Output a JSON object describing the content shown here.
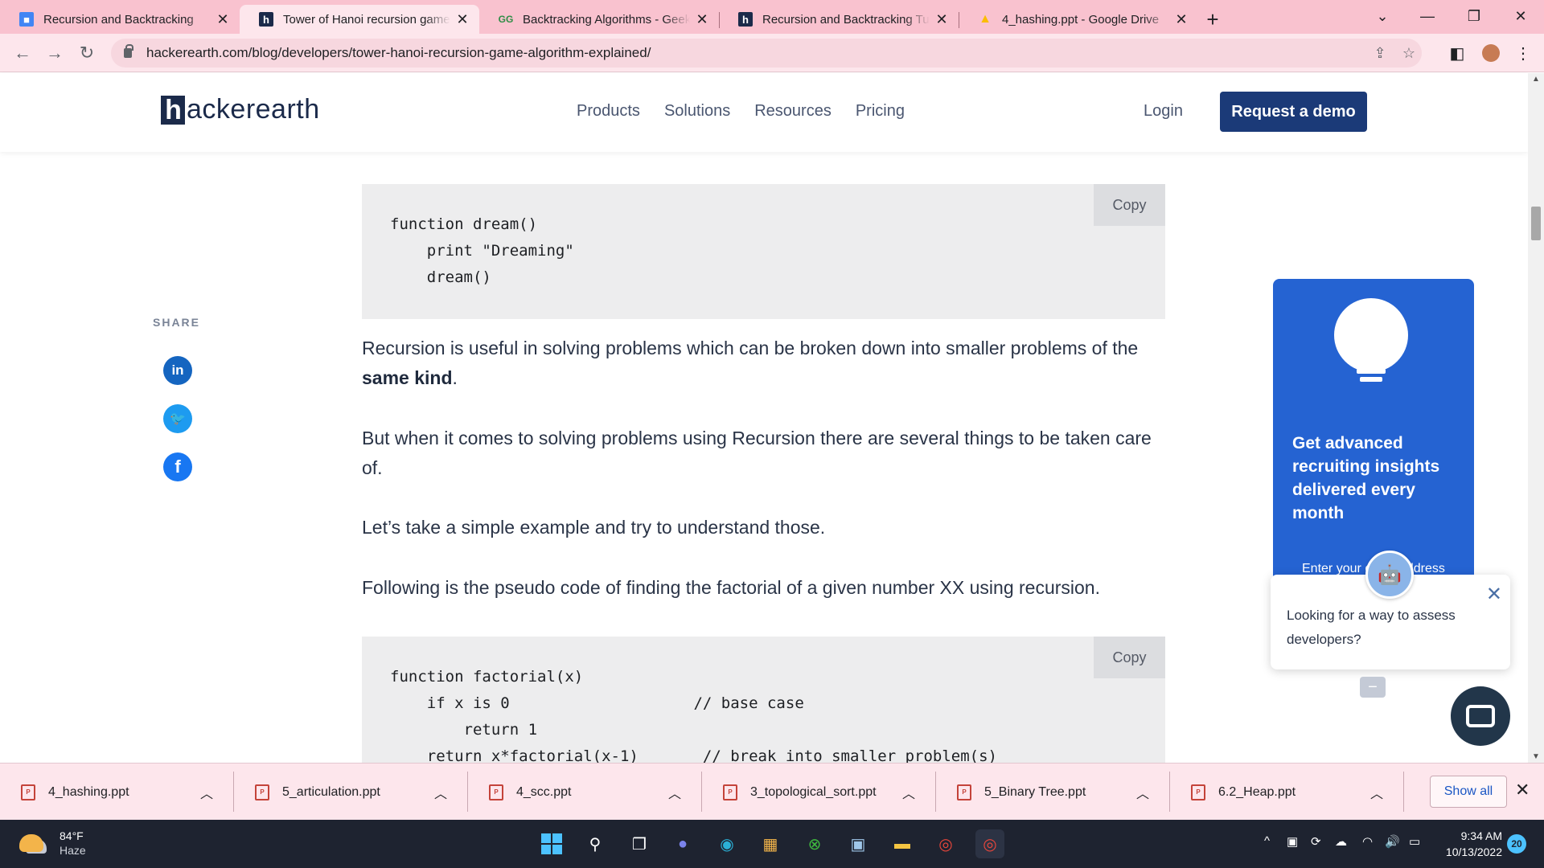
{
  "browser": {
    "tabs": [
      {
        "title": "Recursion and Backtracking",
        "favicon": "account-icon",
        "favicon_color": "#4285f4",
        "active": false
      },
      {
        "title": "Tower of Hanoi recursion game algorithm explained",
        "favicon": "hackerearth-icon",
        "favicon_color": "#1b2a4a",
        "active": true
      },
      {
        "title": "Backtracking Algorithms - GeeksforGeeks",
        "favicon": "geeksforgeeks-icon",
        "favicon_color": "#2f8d46",
        "active": false
      },
      {
        "title": "Recursion and Backtracking Tutorials",
        "favicon": "hackerearth-icon",
        "favicon_color": "#1b2a4a",
        "active": false
      },
      {
        "title": "4_hashing.ppt - Google Drive",
        "favicon": "google-drive-icon",
        "favicon_color": "#fbbc04",
        "active": false
      }
    ],
    "url": "hackerearth.com/blog/developers/tower-hanoi-recursion-game-algorithm-explained/",
    "tab_color": "#f9c2cf"
  },
  "site": {
    "logo_letter": "h",
    "logo_rest": "ackerearth",
    "nav": [
      "Products",
      "Solutions",
      "Resources",
      "Pricing"
    ],
    "login": "Login",
    "cta": "Request a demo",
    "brand_color": "#1b3a78"
  },
  "article": {
    "code1": "function dream()\n    print \"Dreaming\"\n    dream()",
    "copy_label": "Copy",
    "p1_before": "Recursion is useful in solving problems which can be broken down into smaller problems of the ",
    "p1_bold": "same kind",
    "p1_after": ".",
    "p2": "But when it comes to solving problems using Recursion there are several things to be taken care of.",
    "p3": "Let’s take a simple example and try to understand those.",
    "p4": "Following is the pseudo code of finding the factorial of a given number XX using recursion.",
    "code2": "function factorial(x)\n    if x is 0                    // base case\n        return 1\n    return x*factorial(x-1)       // break into smaller problem(s)",
    "share_label": "SHARE",
    "share_icons": [
      "linkedin-icon",
      "twitter-icon",
      "facebook-icon"
    ]
  },
  "sidebar": {
    "promo_headline": "Get advanced recruiting insights delivered every month",
    "promo_email_placeholder": "Enter your email address",
    "chat_message": "Looking for a way to assess developers?",
    "promo_color": "#2563d2"
  },
  "downloads": {
    "items": [
      "4_hashing.ppt",
      "5_articulation.ppt",
      "4_scc.ppt",
      "3_topological_sort.ppt",
      "5_Binary Tree.ppt",
      "6.2_Heap.ppt"
    ],
    "show_all": "Show all"
  },
  "taskbar": {
    "temperature": "84°F",
    "condition": "Haze",
    "time": "9:34 AM",
    "date": "10/13/2022",
    "notifications": "20"
  }
}
